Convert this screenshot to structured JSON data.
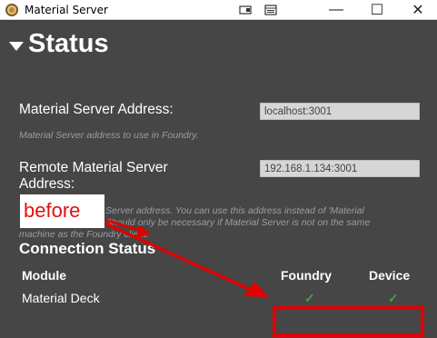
{
  "window": {
    "title": "Material Server",
    "controls": {
      "minimize": "—",
      "maximize": "☐",
      "close": "✕"
    }
  },
  "status": {
    "heading": "Status",
    "server_address": {
      "label": "Material Server Address:",
      "value": "localhost:3001",
      "description": "Material Server address to use in Foundry."
    },
    "remote_address": {
      "label_line1": "Remote Material Server",
      "label_line2": "Address:",
      "value": "192.168.1.134:3001",
      "description_line1": "Server address. You can use this address instead of 'Material",
      "description_line2": "Should only be necessary if Material Server is not on the same",
      "description_line3": "machine as the Foundry client."
    }
  },
  "connection": {
    "title": "Connection Status",
    "columns": {
      "module": "Module",
      "foundry": "Foundry",
      "device": "Device"
    },
    "rows": [
      {
        "module": "Material Deck",
        "foundry": "✓",
        "device": "✓"
      }
    ]
  },
  "annotation": {
    "label": "before",
    "color": "#e00000"
  },
  "colors": {
    "background": "#464646",
    "ok": "#43a047"
  }
}
